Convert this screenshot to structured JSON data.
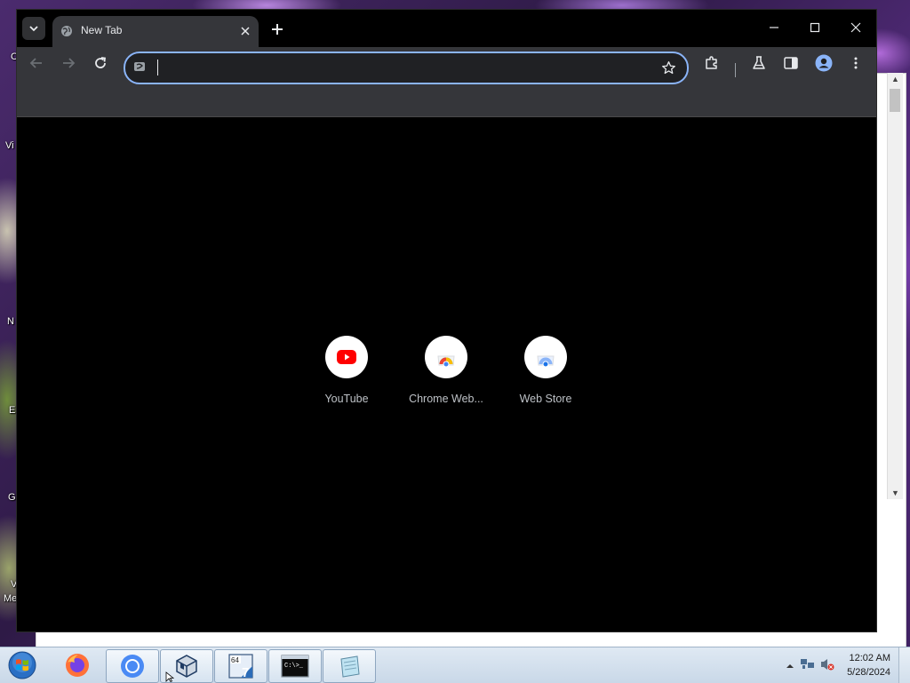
{
  "desktop": {
    "icon_labels": [
      "C",
      "Vi",
      "N",
      "E",
      "G",
      "V",
      "Me"
    ]
  },
  "browser": {
    "tab": {
      "title": "New Tab"
    },
    "omnibox": {
      "value": "",
      "placeholder": ""
    },
    "shortcuts": [
      {
        "label": "YouTube",
        "icon": "youtube-icon"
      },
      {
        "label": "Chrome Web...",
        "icon": "chrome-web-store-icon"
      },
      {
        "label": "Web Store",
        "icon": "web-store-icon"
      }
    ],
    "colors": {
      "accent": "#8ab4f8",
      "frame": "#000000",
      "toolbar": "#35363a",
      "youtube_red": "#ff0000"
    }
  },
  "taskbar": {
    "apps": [
      {
        "name": "Firefox",
        "icon": "firefox-icon"
      },
      {
        "name": "Chromium",
        "icon": "chromium-icon"
      },
      {
        "name": "VirtualBox",
        "icon": "virtualbox-icon"
      },
      {
        "name": "Windows 7 64",
        "icon": "win7-64-icon",
        "badge_top": "64",
        "badge_bottom": "7"
      },
      {
        "name": "Command Prompt",
        "icon": "cmd-icon",
        "text": "C:\\>_"
      },
      {
        "name": "Notepad",
        "icon": "notepad-icon"
      }
    ],
    "clock": {
      "time": "12:02 AM",
      "date": "5/28/2024"
    }
  }
}
